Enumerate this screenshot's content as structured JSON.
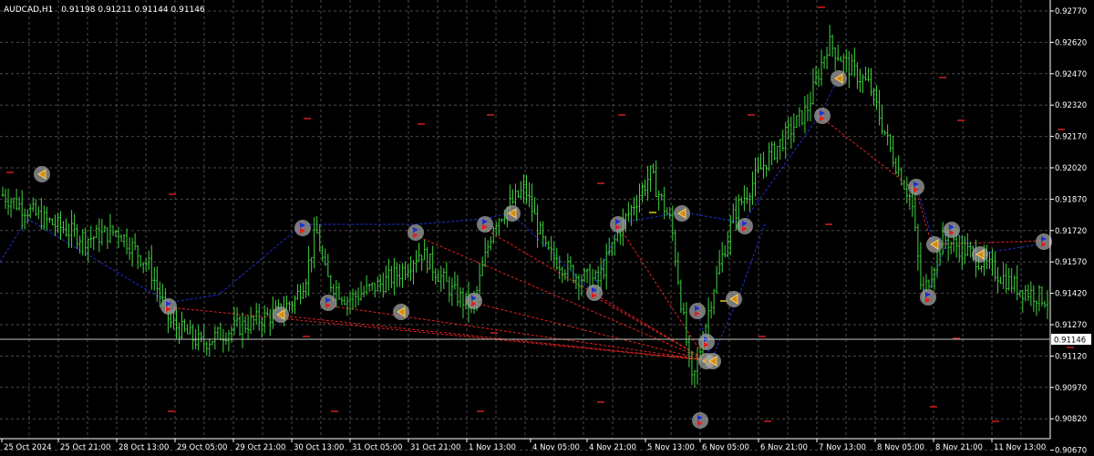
{
  "header": {
    "symbol_tf": "AUDCAD,H1",
    "ohlc": "0.91198 0.91211 0.91144 0.91146"
  },
  "colors": {
    "background": "#000000",
    "grid": "#4a4a4a",
    "candle": "#3fd43f",
    "axis_text": "#ffffff",
    "price_line": "#c0c0c0",
    "blue_line": "#1f2fd0",
    "red_line": "#e02020",
    "marker_ring": "#a0a0a0",
    "red_dash": "#e02020",
    "yellow_dash": "#e0e000"
  },
  "price_axis": {
    "ticks": [
      "0.92770",
      "0.92620",
      "0.92470",
      "0.92320",
      "0.92170",
      "0.92020",
      "0.91870",
      "0.91720",
      "0.91570",
      "0.91420",
      "0.91270",
      "0.91120",
      "0.90970",
      "0.90820",
      "0.90670"
    ],
    "current_price": "0.91146"
  },
  "time_axis": {
    "labels": [
      "25 Oct 2024",
      "25 Oct 21:00",
      "28 Oct 13:00",
      "29 Oct 05:00",
      "29 Oct 21:00",
      "30 Oct 13:00",
      "31 Oct 05:00",
      "31 Oct 21:00",
      "1 Nov 13:00",
      "4 Nov 05:00",
      "4 Nov 21:00",
      "5 Nov 13:00",
      "6 Nov 05:00",
      "6 Nov 21:00",
      "7 Nov 13:00",
      "8 Nov 05:00",
      "8 Nov 21:00",
      "11 Nov 13:00"
    ]
  },
  "chart_data": {
    "type": "candlestick",
    "symbol": "AUDCAD",
    "timeframe": "H1",
    "ylim": [
      0.9061,
      0.9282
    ],
    "last_price": 0.91146,
    "grid": true,
    "close_path": [
      [
        0,
        0.9189
      ],
      [
        0.04,
        0.9177
      ],
      [
        0.08,
        0.9168
      ],
      [
        0.11,
        0.9172
      ],
      [
        0.14,
        0.9155
      ],
      [
        0.16,
        0.9128
      ],
      [
        0.19,
        0.9118
      ],
      [
        0.22,
        0.9125
      ],
      [
        0.26,
        0.9132
      ],
      [
        0.28,
        0.9139
      ],
      [
        0.29,
        0.915
      ],
      [
        0.3,
        0.9172
      ],
      [
        0.31,
        0.9149
      ],
      [
        0.33,
        0.9139
      ],
      [
        0.36,
        0.9146
      ],
      [
        0.38,
        0.9152
      ],
      [
        0.4,
        0.9162
      ],
      [
        0.43,
        0.9143
      ],
      [
        0.45,
        0.9135
      ],
      [
        0.47,
        0.9176
      ],
      [
        0.5,
        0.9192
      ],
      [
        0.52,
        0.9162
      ],
      [
        0.55,
        0.915
      ],
      [
        0.57,
        0.9148
      ],
      [
        0.59,
        0.9172
      ],
      [
        0.62,
        0.9199
      ],
      [
        0.64,
        0.9175
      ],
      [
        0.65,
        0.9135
      ],
      [
        0.66,
        0.9098
      ],
      [
        0.68,
        0.9144
      ],
      [
        0.7,
        0.918
      ],
      [
        0.73,
        0.9205
      ],
      [
        0.77,
        0.923
      ],
      [
        0.79,
        0.9262
      ],
      [
        0.81,
        0.925
      ],
      [
        0.83,
        0.9241
      ],
      [
        0.85,
        0.921
      ],
      [
        0.87,
        0.9186
      ],
      [
        0.88,
        0.914
      ],
      [
        0.9,
        0.9168
      ],
      [
        0.92,
        0.9163
      ],
      [
        0.94,
        0.9156
      ],
      [
        0.97,
        0.9145
      ],
      [
        1.0,
        0.9139
      ]
    ],
    "horizontal_lines": [
      {
        "price": 0.91146,
        "style": "solid",
        "label": "0.91146"
      }
    ]
  }
}
